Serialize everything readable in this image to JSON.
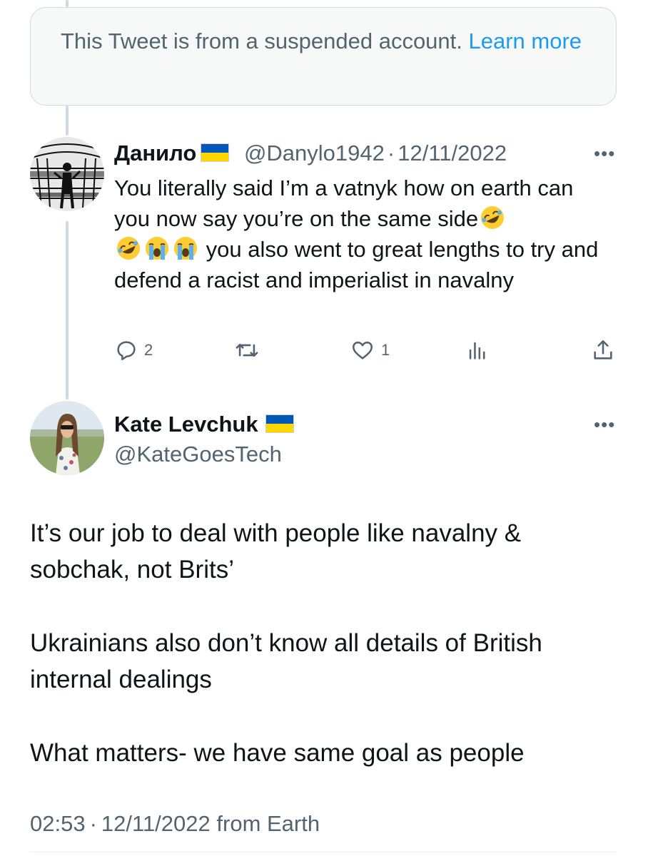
{
  "suspended_notice": {
    "text": "This Tweet is from a suspended account.",
    "link": "Learn more"
  },
  "reply": {
    "display_name": "Данило",
    "flag": "ukraine-flag",
    "handle": "@Danylo1942",
    "separator": "·",
    "date": "12/11/2022",
    "text_part1": "You literally said I’m a vatnyk how on earth can you now say you’re on the same side",
    "text_part2": "you also went to great lengths to try and defend a racist and imperialist in navalny",
    "emojis": [
      "rofl",
      "rofl",
      "sob",
      "sob"
    ],
    "actions": {
      "replies": "2",
      "retweets": "",
      "likes": "1",
      "views": ""
    }
  },
  "main_tweet": {
    "display_name": "Kate Levchuk",
    "flag": "ukraine-flag",
    "handle": "@KateGoesTech",
    "paragraphs": [
      "It’s our job to deal with people like navalny & sobchak, not Brits’",
      "Ukrainians also don’t know all details of British internal dealings",
      "What matters- we have same goal as people"
    ],
    "time": "02:53",
    "separator": "·",
    "date": "12/11/2022",
    "source": "from Earth"
  },
  "colors": {
    "link": "#1d9bf0",
    "muted": "#536471",
    "text": "#0f1419",
    "thread_line": "#cfd9de"
  }
}
